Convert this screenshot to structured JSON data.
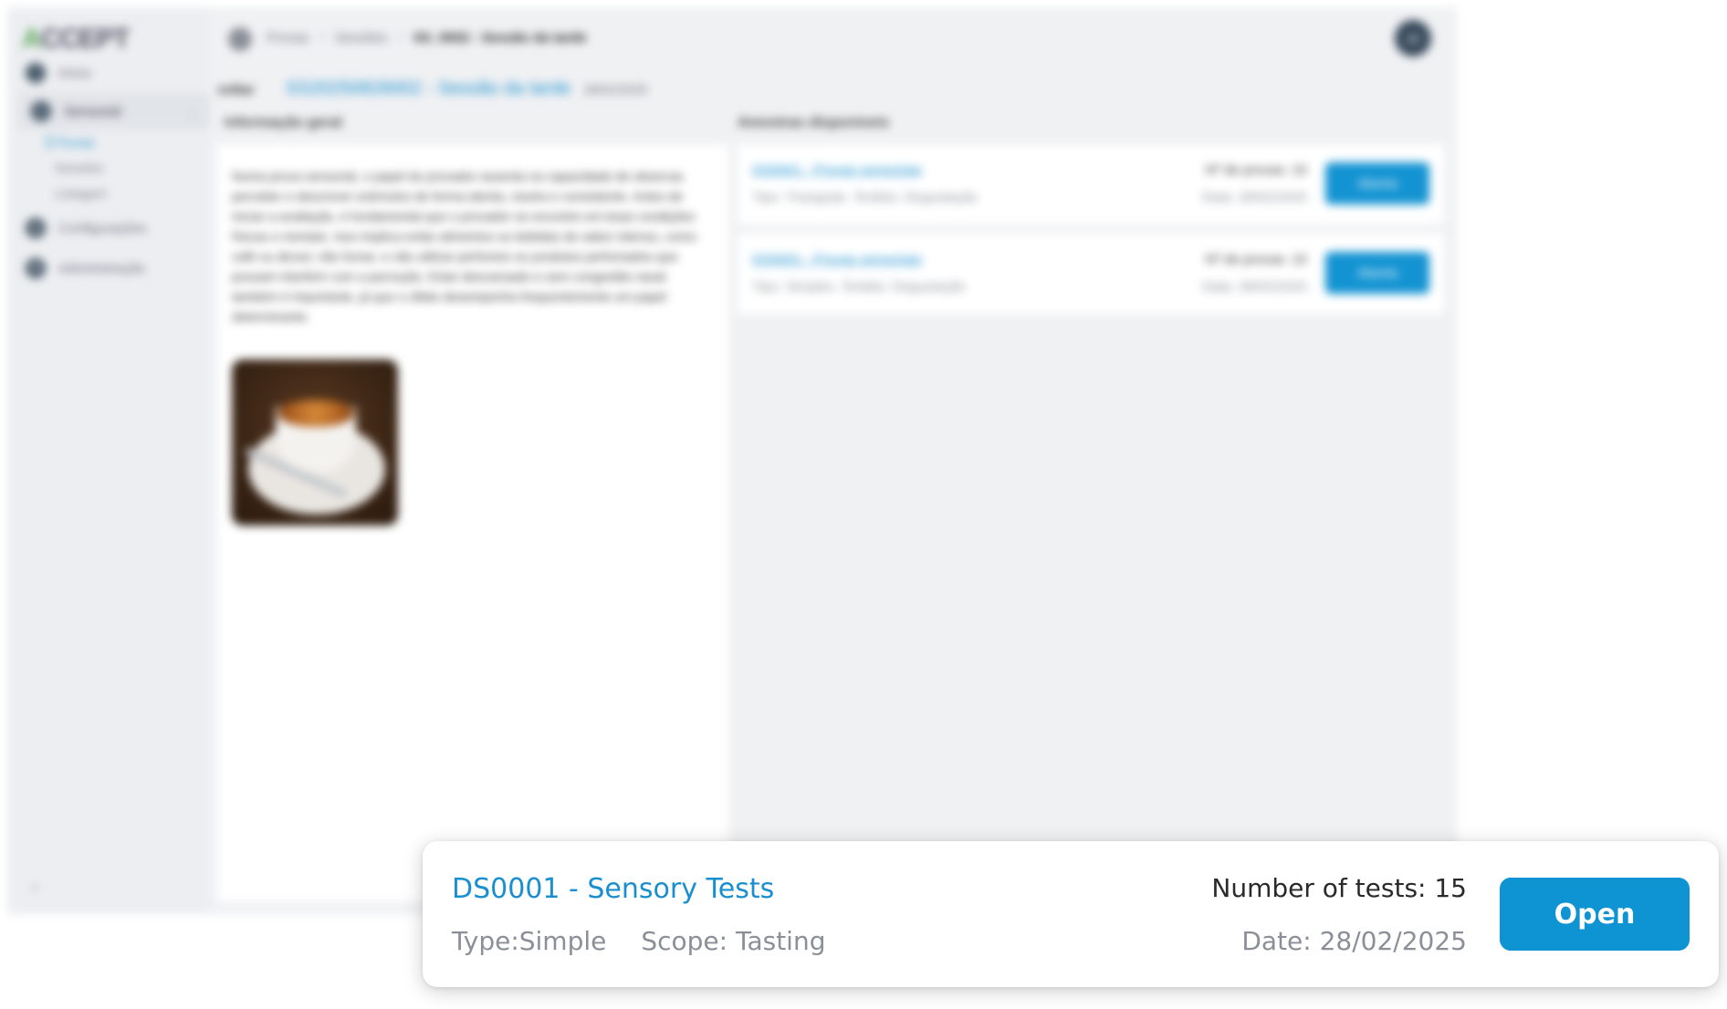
{
  "app": {
    "logo": "CCEPT",
    "logo_mark": "A"
  },
  "sidebar": {
    "items": [
      {
        "label": "Início",
        "icon": "home-icon"
      },
      {
        "label": "Sensorial",
        "icon": "sensory-icon"
      },
      {
        "label": "Configurações",
        "icon": "gear-icon"
      },
      {
        "label": "Administração",
        "icon": "admin-icon"
      }
    ],
    "subitems": [
      "Provas",
      "Sessões",
      "Listagem"
    ],
    "collapse_label": "«"
  },
  "header": {
    "breadcrumbs": [
      "Provas",
      "Sessões",
      "SS_0002 - Sessão da tarde"
    ],
    "separator": "/",
    "avatar_initials": "JD"
  },
  "session": {
    "back_label": "voltar",
    "title": "SS20250826002 - Sessão da tarde",
    "date": "28/02/2025"
  },
  "info": {
    "title": "Informação geral",
    "text": "Numa prova sensorial, o papel do provador assenta na capacidade de observar, perceber e descrever estímulos de forma atenta, neutra e consistente. Antes de iniciar a avaliação, é fundamental que o provador se encontre em boas condições físicas e mentais. Isso implica evitar alimentos ou bebidas de sabor intenso, como café ou álcool, não fumar, e não utilizar perfumes ou produtos perfumados que possam interferir com a perceção. Estar descansado e sem congestão nasal também é importante, já que o olfato desempenha frequentemente um papel determinante."
  },
  "samples": {
    "title": "Amostras disponíveis",
    "rows": [
      {
        "name": "DS0001 - Provas sensoriais",
        "type": "Tipo: Triangular",
        "scope": "Âmbito: Degustação",
        "count": "Nº de provas: 15",
        "date": "Data: 28/02/2025",
        "button": "Aberta"
      },
      {
        "name": "DS0001 - Provas sensoriais",
        "type": "Tipo: Simples",
        "scope": "Âmbito: Degustação",
        "count": "Nº de provas: 15",
        "date": "Data: 28/02/2025",
        "button": "Aberta"
      }
    ]
  },
  "focus_card": {
    "name": "DS0001 - Sensory Tests",
    "type": "Type:Simple",
    "scope": "Scope: Tasting",
    "count": "Number of tests: 15",
    "date": "Date: 28/02/2025",
    "button": "Open"
  },
  "colors": {
    "accent": "#1393d2",
    "link": "#1a8fd0",
    "muted_text": "#8a8f98",
    "app_bg": "#f0f1f3"
  }
}
